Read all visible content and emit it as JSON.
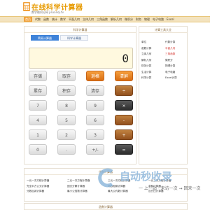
{
  "header": {
    "logo_title": "在线科学计算器",
    "logo_subtitle": "数学微积分网 jisuanqi.tv"
  },
  "nav": {
    "items": [
      "首页",
      "代数",
      "函数",
      "统计",
      "数学",
      "平面几何",
      "立体几何",
      "三角函数",
      "解析几何",
      "微积分",
      "財务",
      "物理",
      "电子电路",
      "Excel"
    ]
  },
  "calculator": {
    "panel_title": "科学计算器",
    "tabs": [
      "简易计算器",
      "科学计算器"
    ],
    "display_value": "0",
    "buttons": [
      [
        "存储",
        "取存",
        "退格",
        "清屏"
      ],
      [
        "累存",
        "积存",
        "清存",
        "÷"
      ],
      [
        "7",
        "8",
        "9",
        "×"
      ],
      [
        "4",
        "5",
        "6",
        "-"
      ],
      [
        "1",
        "2",
        "3",
        "+"
      ],
      [
        "0",
        ".",
        "+/-",
        "="
      ]
    ]
  },
  "sidebar": {
    "title": "计算工具大全",
    "rows": [
      [
        "单位",
        "代数计算"
      ],
      [
        "函数计算",
        "平面几何"
      ],
      [
        "立体几何",
        "三角函数"
      ],
      [
        "解析几何",
        "微积分"
      ],
      [
        "财务计算",
        "物理计算"
      ],
      [
        "生活计算",
        "电子电路"
      ],
      [
        "科学计算",
        "Excel计算"
      ],
      [
        "",
        ""
      ]
    ],
    "red_links": [
      "平面几何",
      "三角函数"
    ]
  },
  "algebra": {
    "panel_title": "代数计算器",
    "links": [
      "一元一次方程计算器",
      "二元一次方程计算器",
      "三元一次方程计算器",
      "一元二次方程计算器",
      "完全平方公式计算器",
      "因式分解计算器",
      "两数相乘计算器",
      "求和计算器",
      "分数加减计算器",
      "最小公倍数计算器",
      "最大公约数计算器",
      "百分比计算器"
    ]
  },
  "functions_panel": {
    "title": "函数计算器"
  },
  "watermark": {
    "title": "自动秒收录",
    "subtitle": "一 上一站 · 来访一次 → 回来一次"
  },
  "colors": {
    "accent": "#f0a13c",
    "nav_bg": "#f3e3bf",
    "display_bg": "#fff9df"
  }
}
